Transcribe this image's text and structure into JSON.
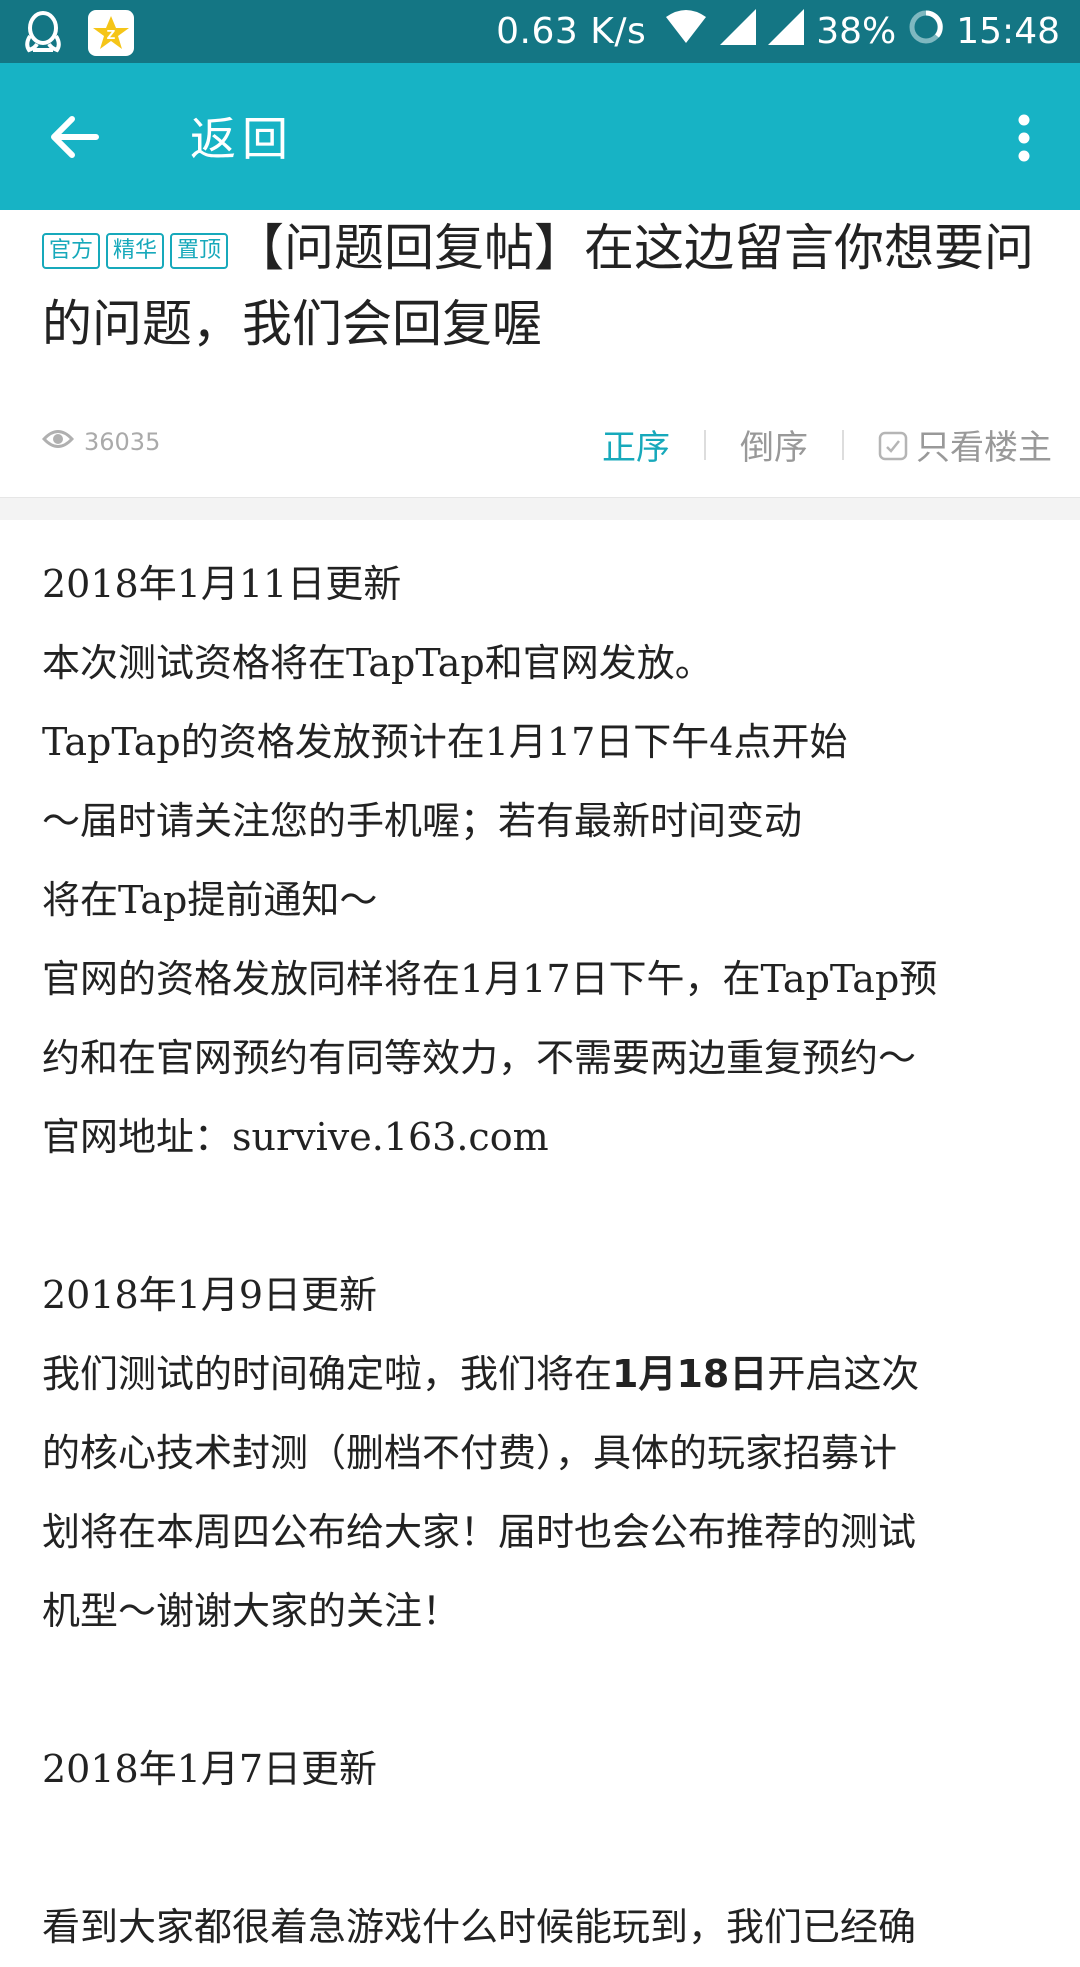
{
  "status_bar": {
    "network_speed": "0.63 K/s",
    "battery": "38%",
    "time": "15:48"
  },
  "header": {
    "title": "返回"
  },
  "post": {
    "tags": [
      "官方",
      "精华",
      "置顶"
    ],
    "title": "【问题回复帖】在这边留言你想要问的问题，我们会回复喔",
    "views": "36035",
    "sort_asc_label": "正序",
    "sort_desc_label": "倒序",
    "only_op_label": "只看楼主"
  },
  "body": {
    "line1": "2018年1月11日更新",
    "line2": "本次测试资格将在TapTap和官网发放。",
    "line3": "TapTap的资格发放预计在1月17日下午4点开始",
    "line4": "～届时请关注您的手机喔；若有最新时间变动",
    "line5": "将在Tap提前通知～",
    "line6": "官网的资格发放同样将在1月17日下午，在TapTap预",
    "line7": "约和在官网预约有同等效力，不需要两边重复预约～",
    "line8": "官网地址：survive.163.com",
    "line9": "2018年1月9日更新",
    "line10_pre": "我们测试的时间确定啦，我们将在",
    "line10_bold": "1月18日",
    "line10_post": "开启这次",
    "line11": "的核心技术封测（删档不付费），具体的玩家招募计",
    "line12": "划将在本周四公布给大家！届时也会公布推荐的测试",
    "line13": "机型～谢谢大家的关注！",
    "line14": "2018年1月7日更新",
    "line15": "看到大家都很着急游戏什么时候能玩到，我们已经确"
  },
  "colors": {
    "status_bar": "#147684",
    "header": "#17b3c5",
    "accent": "#17a9bb"
  }
}
